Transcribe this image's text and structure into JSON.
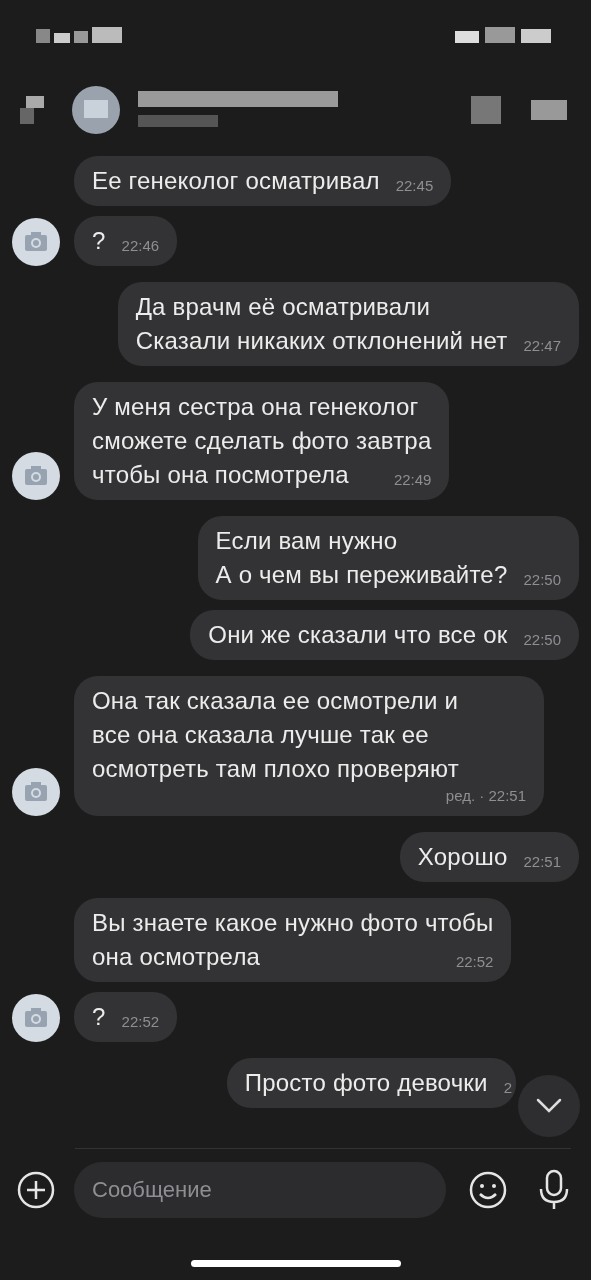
{
  "messages": [
    {
      "kind": "incoming",
      "avatar": false,
      "lines": [
        "Ее генеколог осматривал"
      ],
      "time": "22:45"
    },
    {
      "kind": "incoming",
      "avatar": true,
      "lines": [
        "?"
      ],
      "time": "22:46"
    },
    {
      "kind": "outgoing",
      "avatar": false,
      "lines": [
        "Да врачм её осматривали",
        "Сказали никаких отклонений нет"
      ],
      "time": "22:47"
    },
    {
      "kind": "incoming",
      "avatar": true,
      "lines": [
        "У меня сестра она генеколог",
        "сможете сделать фото завтра",
        "чтобы она посмотрела"
      ],
      "time": "22:49"
    },
    {
      "kind": "outgoing",
      "avatar": false,
      "lines": [
        "Если вам нужно",
        "А о чем вы переживайте?"
      ],
      "time": "22:50"
    },
    {
      "kind": "outgoing",
      "avatar": false,
      "lines": [
        "Они же сказали что все ок"
      ],
      "time": "22:50"
    },
    {
      "kind": "incoming",
      "avatar": true,
      "lines": [
        "Она так сказала ее осмотрели и",
        "все она сказала лучше так ее",
        "осмотреть там плохо проверяют"
      ],
      "time": "ред. · 22:51"
    },
    {
      "kind": "outgoing",
      "avatar": false,
      "lines": [
        "Хорошо"
      ],
      "time": "22:51"
    },
    {
      "kind": "incoming",
      "avatar": false,
      "lines": [
        "Вы знаете какое нужно фото чтобы",
        "она осмотрела"
      ],
      "time": "22:52"
    },
    {
      "kind": "incoming",
      "avatar": true,
      "lines": [
        "?"
      ],
      "time": "22:52"
    },
    {
      "kind": "outgoing",
      "avatar": false,
      "lines": [
        "Просто фото девочки"
      ],
      "time": "2"
    }
  ],
  "composer": {
    "placeholder": "Сообщение"
  }
}
